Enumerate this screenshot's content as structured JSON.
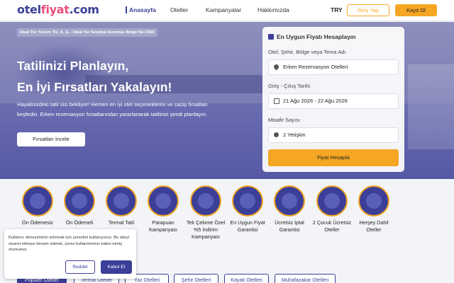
{
  "header": {
    "logo_part1": "otel",
    "logo_part2": "fiyat",
    "logo_part3": ".com",
    "nav": [
      "Anasayfa",
      "Oteller",
      "Kampanyalar",
      "Hakkımızda"
    ],
    "currency": "TRY",
    "login_label": "Giriş Yap",
    "register_label": "Kayıt Ol"
  },
  "hero": {
    "agency_badge": "İdeal Tur Turizm Tic. A. Ş. - İdeal Tur Seyahat Acentası Belge No:3304",
    "title_line1": "Tatilinizi Planlayın,",
    "title_line2": "En İyi Fırsatları Yakalayın!",
    "description": "Hayalinizdeki tatil sizi bekliyor! Hemen en iyi otel seçeneklerini ve cazip fırsatları keşfedin. Erken rezervasyon fırsatlarından yararlanarak tatilinizi şimdi planlayın.",
    "explore_label": "Fırsatları İncele"
  },
  "search": {
    "title": "En Uygun Fiyatı Hesaplayın",
    "location_label": "Otel, Şehir, Bölge veya Tema Adı",
    "location_value": "Erken Rezervasyon Otelleri",
    "dates_label": "Giriş - Çıkış Tarihi",
    "dates_value": "21 Ağu 2026 - 22 Ağu 2026",
    "guests_label": "Misafir Sayısı",
    "guests_value": "2 Yetişkin",
    "calc_label": "Fiyat Hesapla"
  },
  "features": [
    {
      "label": "Ön Ödemesiz"
    },
    {
      "label": "Ön Ödemeli"
    },
    {
      "label": "Termal Tatil"
    },
    {
      "label": "Parapuan Kampanyası"
    },
    {
      "label": "Tek Çekime Özel %5 İndirim Kampanyası"
    },
    {
      "label": "En Uygun Fiyat Garantisi"
    },
    {
      "label": "Ücretsiz İptal Garantisi"
    },
    {
      "label": "2 Çocuk Ücretsiz Oteller"
    },
    {
      "label": "Herşey Dahil Oteller"
    }
  ],
  "cookie": {
    "text": "Kullanıcı deneyiminizi artırmak için çerezleri kullanıyoruz. Bu siteyi ziyaret etmeye devam ederek, çerez kullanımımızı kabul etmiş olursunuz.",
    "reject_label": "Reddet",
    "accept_label": "Kabul Et"
  },
  "chips": [
    "Popüler Oteller",
    "Termal Oteller",
    "Yaz Otelleri",
    "Şehir Otelleri",
    "Kayak Otelleri",
    "Muhafazakar Otelleri"
  ],
  "colors": {
    "brand": "#3b3f98",
    "accent": "#f5a623",
    "logo_pink": "#e94e77"
  }
}
